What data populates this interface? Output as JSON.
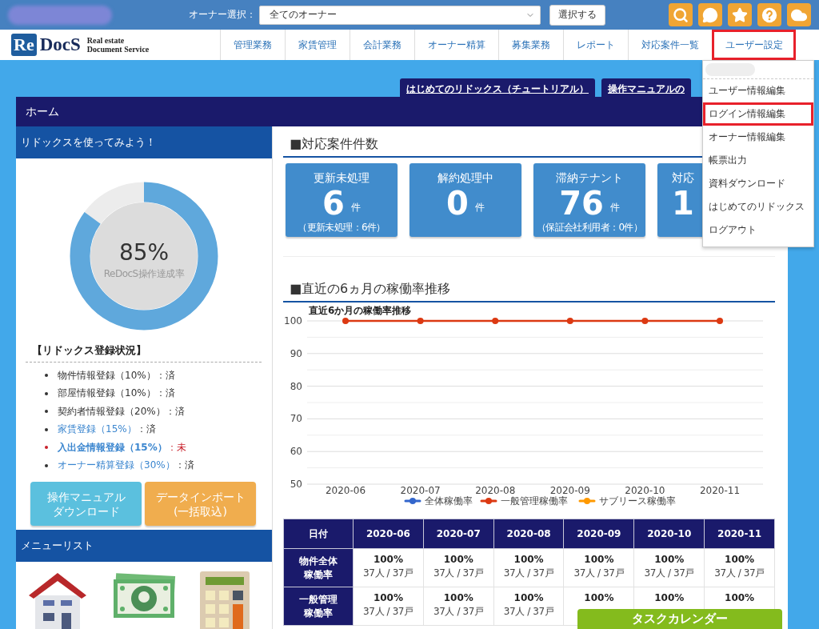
{
  "top_bar": {
    "owner_label": "オーナー選択：",
    "owner_select": {
      "value": "全てのオーナー"
    },
    "select_button": "選択する"
  },
  "logo": {
    "mark": "Re",
    "name": "DocS",
    "tagline": [
      "Real estate",
      "Document Service"
    ]
  },
  "nav": [
    {
      "label": "管理業務",
      "highlighted": false
    },
    {
      "label": "家賃管理",
      "highlighted": false
    },
    {
      "label": "会計業務",
      "highlighted": false
    },
    {
      "label": "オーナー精算",
      "highlighted": false
    },
    {
      "label": "募集業務",
      "highlighted": false
    },
    {
      "label": "レポート",
      "highlighted": false
    },
    {
      "label": "対応案件一覧",
      "highlighted": false
    },
    {
      "label": "ユーザー設定",
      "highlighted": true
    }
  ],
  "user_menu": {
    "items": [
      {
        "label": "ユーザー情報編集",
        "highlighted": false
      },
      {
        "label": "ログイン情報編集",
        "highlighted": true
      },
      {
        "label": "オーナー情報編集",
        "highlighted": false
      },
      {
        "label": "帳票出力",
        "highlighted": false
      },
      {
        "label": "資料ダウンロード",
        "highlighted": false
      },
      {
        "label": "はじめてのリドックス",
        "highlighted": false
      },
      {
        "label": "ログアウト",
        "highlighted": false
      }
    ]
  },
  "tabs": [
    {
      "label": "はじめてのリドックス（チュートリアル）"
    },
    {
      "label": "操作マニュアルの"
    }
  ],
  "home": {
    "title": "ホーム"
  },
  "getting_started": {
    "title": "リドックスを使ってみよう！",
    "progress": {
      "level": 0.85,
      "value": "85%",
      "caption": "ReDocS操作達成率"
    },
    "status_title": "【リドックス登録状況】",
    "status_items": [
      {
        "label": "物件情報登録（10%）",
        "result": "：済",
        "linked": false,
        "done": true
      },
      {
        "label": "部屋情報登録（10%）",
        "result": "：済",
        "linked": false,
        "done": true
      },
      {
        "label": "契約者情報登録（20%）",
        "result": "：済",
        "linked": false,
        "done": true
      },
      {
        "label": "家賃登録（15%）",
        "result": "：済",
        "linked": true,
        "done": true
      },
      {
        "label": "入出金情報登録（15%）",
        "result": "：未",
        "linked": true,
        "done": false
      },
      {
        "label": "オーナー精算登録（30%）",
        "result": "：済",
        "linked": true,
        "done": true
      }
    ],
    "buttons": [
      {
        "lines": [
          "操作マニュアル",
          "ダウンロード"
        ],
        "color": "#5bc0de"
      },
      {
        "lines": [
          "データインポート",
          "(一括取込)"
        ],
        "color": "#f0ad4e"
      }
    ]
  },
  "menu_list": {
    "title": "メニューリスト"
  },
  "case_counts": {
    "title": "■対応案件件数",
    "cards": [
      {
        "title": "更新未処理",
        "count": "6",
        "unit": "件",
        "note": "（更新未処理：6件）",
        "partial": false
      },
      {
        "title": "解約処理中",
        "count": "0",
        "unit": "件",
        "partial": false
      },
      {
        "title": "滞納テナント",
        "count": "76",
        "unit": "件",
        "note": "（保証会社利用者：0件）",
        "partial": false
      },
      {
        "title": "対応",
        "count": "1",
        "partial": true
      }
    ]
  },
  "occupancy": {
    "title": "■直近の6ヵ月の稼働率推移",
    "chart_data": {
      "type": "line",
      "title": "直近6か月の稼働率推移",
      "categories": [
        "2020-06",
        "2020-07",
        "2020-08",
        "2020-09",
        "2020-10",
        "2020-11"
      ],
      "series": [
        {
          "name": "全体稼働率",
          "color": "#3366cc",
          "marker": "circle",
          "values": [
            null,
            null,
            null,
            null,
            null,
            null
          ]
        },
        {
          "name": "一般管理稼働率",
          "color": "#dc3912",
          "marker": "circle",
          "values": [
            100,
            100,
            100,
            100,
            100,
            100
          ]
        },
        {
          "name": "サブリース稼働率",
          "color": "#ff9900",
          "marker": "circle",
          "values": [
            null,
            null,
            null,
            null,
            null,
            null
          ]
        }
      ],
      "ylim": [
        50,
        100
      ],
      "yticks": [
        50,
        60,
        70,
        80,
        90,
        100
      ],
      "grid": true
    },
    "table": {
      "corner": "日付",
      "columns": [
        "2020-06",
        "2020-07",
        "2020-08",
        "2020-09",
        "2020-10",
        "2020-11"
      ],
      "rows": [
        {
          "label": [
            "物件全体",
            "稼働率"
          ],
          "cells": [
            {
              "rate": "100%",
              "count": "37人 / 37戸"
            },
            {
              "rate": "100%",
              "count": "37人 / 37戸"
            },
            {
              "rate": "100%",
              "count": "37人 / 37戸"
            },
            {
              "rate": "100%",
              "count": "37人 / 37戸"
            },
            {
              "rate": "100%",
              "count": "37人 / 37戸"
            },
            {
              "rate": "100%",
              "count": "37人 / 37戸"
            }
          ]
        },
        {
          "label": [
            "一般管理",
            "稼働率"
          ],
          "cells": [
            {
              "rate": "100%",
              "count": "37人 / 37戸"
            },
            {
              "rate": "100%",
              "count": "37人 / 37戸"
            },
            {
              "rate": "100%",
              "count": "37人 / 37戸"
            },
            {
              "rate": "100%"
            },
            {
              "rate": "100%"
            },
            {
              "rate": "100%"
            }
          ]
        }
      ]
    }
  },
  "task_calendar": {
    "label": "タスクカレンダー"
  }
}
